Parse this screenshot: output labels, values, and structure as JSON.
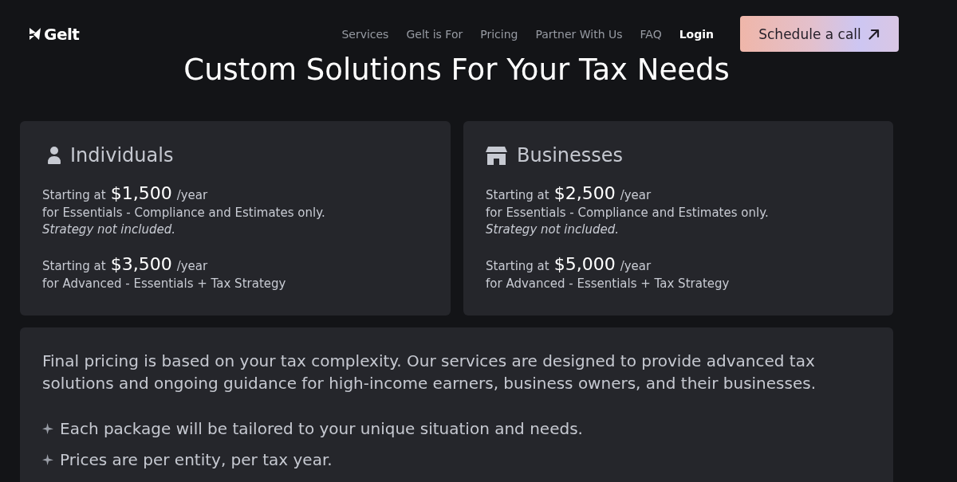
{
  "header": {
    "logo": {
      "text": "Gelt"
    },
    "nav": [
      {
        "label": "Services",
        "kind": "link"
      },
      {
        "label": "Gelt is For",
        "kind": "link"
      },
      {
        "label": "Pricing",
        "kind": "link"
      },
      {
        "label": "Partner With Us",
        "kind": "link"
      },
      {
        "label": "FAQ",
        "kind": "link"
      },
      {
        "label": "Login",
        "kind": "account"
      }
    ],
    "cta": {
      "label": "Schedule a call"
    }
  },
  "title": "Custom Solutions For Your Tax Needs",
  "plans": [
    {
      "kind": "individual",
      "name": "Individuals",
      "tiers": [
        {
          "prefix": "Starting at",
          "price": "$1,500",
          "unit": "/year",
          "description": "for Essentials - Compliance and Estimates only.",
          "note": "Strategy not included."
        },
        {
          "prefix": "Starting at",
          "price": "$3,500",
          "unit": "/year",
          "description": "for Advanced - Essentials + Tax Strategy"
        }
      ]
    },
    {
      "kind": "business",
      "name": "Businesses",
      "tiers": [
        {
          "prefix": "Starting at",
          "price": "$2,500",
          "unit": "/year",
          "description": "for Essentials - Compliance and Estimates only.",
          "note": "Strategy not included."
        },
        {
          "prefix": "Starting at",
          "price": "$5,000",
          "unit": "/year",
          "description": "for Advanced - Essentials + Tax Strategy"
        }
      ]
    }
  ],
  "notice": {
    "text": "Final pricing is based on your tax complexity. Our services are designed to provide advanced tax solutions and ongoing guidance for high-income earners, business owners, and their businesses.",
    "bullets": [
      "Each package will be tailored to your unique situation and needs.",
      "Prices are per entity, per tax year."
    ]
  }
}
